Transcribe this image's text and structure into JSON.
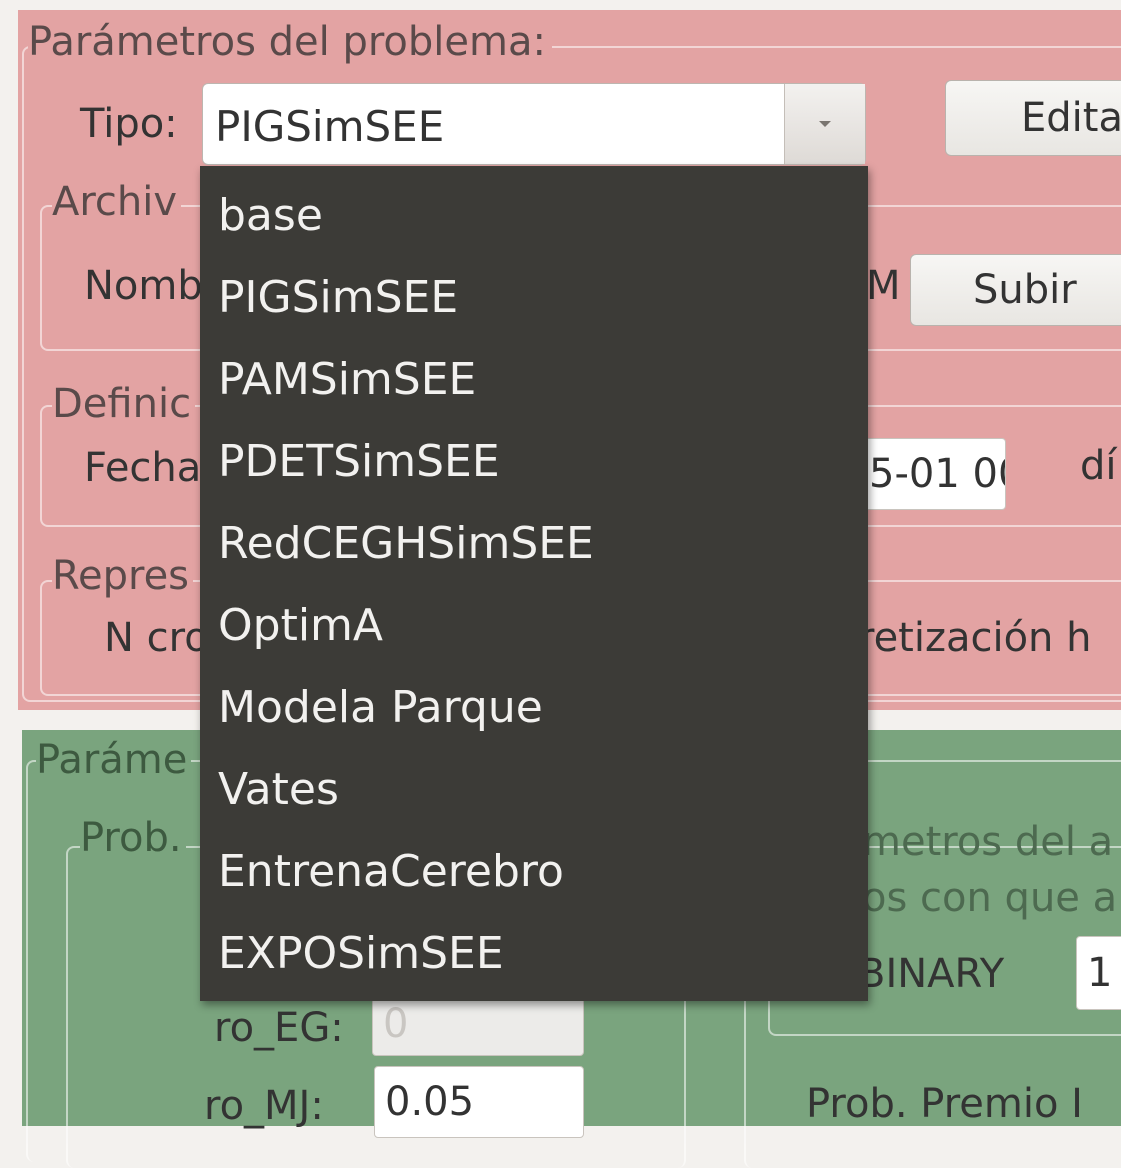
{
  "problem_params": {
    "legend": "Parámetros del problema:",
    "tipo_label": "Tipo:",
    "tipo_value": "PIGSimSEE",
    "edit_button": "Edita",
    "archivo_legend": "Archiv",
    "nombre_label": "Nomb",
    "nombre_tail": "M",
    "upload_button": "Subir",
    "definicion_legend": "Definic",
    "fecha_label": "Fecha",
    "fecha_value": "5-01 00",
    "dias_label": "dí",
    "repres_legend": "Repres",
    "ncro_label": "N cro",
    "discretizacion_label": "retización h"
  },
  "dropdown": {
    "items": [
      "base",
      "PIGSimSEE",
      "PAMSimSEE",
      "PDETSimSEE",
      "RedCEGHSimSEE",
      "OptimA",
      "Modela Parque",
      "Vates",
      "EntrenaCerebro",
      "EXPOSimSEE"
    ]
  },
  "algorithm_params": {
    "legend": "Paráme",
    "prob_legend": "Prob.",
    "ro_eg_label": "ro_EG:",
    "ro_eg_value": "0",
    "ro_mj_label": "ro_MJ:",
    "ro_mj_value": "0.05",
    "metros_line1": "metros del a",
    "metros_line2": "os con que a",
    "binary_label": "BINARY",
    "binary_value": "1",
    "premio_label": "Prob. Premio I"
  },
  "colors": {
    "problem_bg": "#e3a3a3",
    "algorithm_bg": "#7aa47e",
    "dropdown_bg": "#3c3b37"
  }
}
